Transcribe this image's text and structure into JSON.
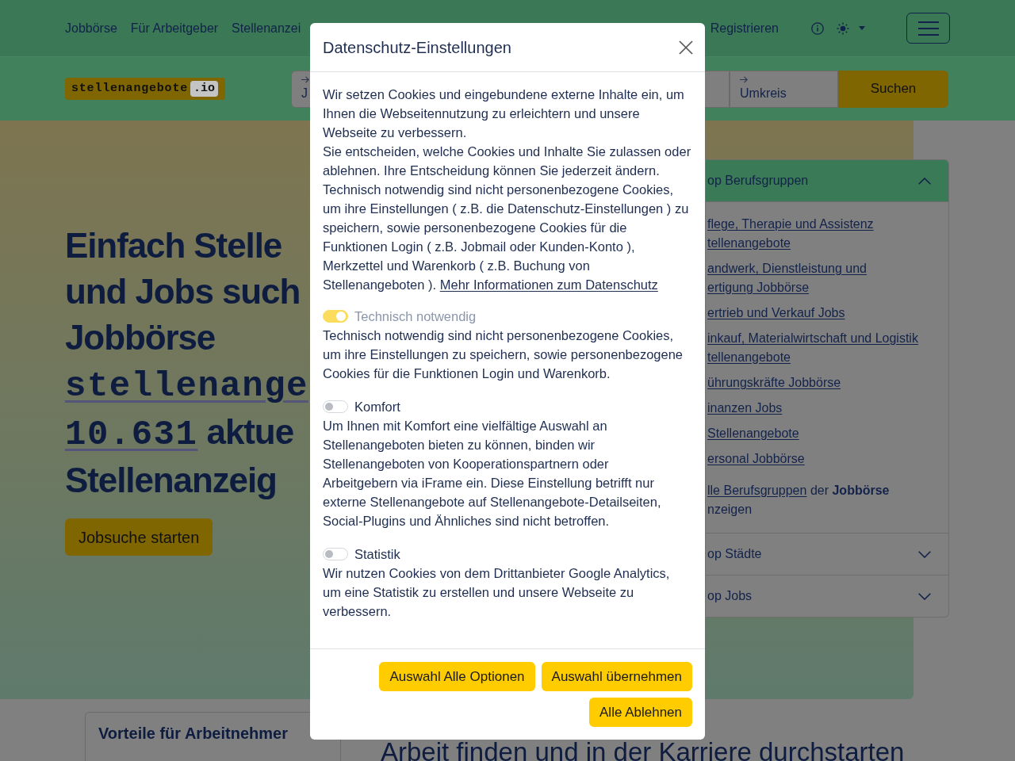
{
  "nav": {
    "links": [
      {
        "text": "Jobbörse"
      },
      {
        "text": "Für Arbeitgeber"
      },
      {
        "text": "Stellenanzei"
      }
    ],
    "register": "Registrieren"
  },
  "search_bar": {
    "logo": {
      "name": "stellenangebote",
      "suffix": ".io"
    },
    "fields": [
      {
        "value": "J"
      },
      {
        "value": "Umkreis"
      }
    ],
    "button": "Suchen"
  },
  "hero": {
    "heading_lines": [
      [
        {
          "kind": "text",
          "text": "Einfach Stelle"
        }
      ],
      [
        {
          "kind": "text",
          "text": "und Jobs such"
        }
      ],
      [
        {
          "kind": "text",
          "text": "Jobbörse"
        }
      ],
      [
        {
          "kind": "link",
          "text": "stellenange"
        }
      ],
      [
        {
          "kind": "link",
          "text": "10.631"
        },
        {
          "kind": "text",
          "text": "aktue"
        }
      ],
      [
        {
          "kind": "text",
          "text": "Stellenanzeig"
        }
      ]
    ],
    "button": "Jobsuche starten"
  },
  "accordion": [
    {
      "title": "op Berufsgruppen",
      "expanded": true,
      "links": [
        {
          "lines": [
            "flege, Therapie und Assistenz",
            "tellenangebote"
          ]
        },
        {
          "lines": [
            "andwerk, Dienstleistung und",
            "ertigung Jobbörse"
          ]
        },
        {
          "lines": [
            "ertrieb und Verkauf Jobs"
          ]
        },
        {
          "lines": [
            "inkauf, Materialwirtschaft und Logistik",
            "tellenangebote"
          ]
        },
        {
          "lines": [
            "ührungskräfte Jobbörse"
          ]
        },
        {
          "lines": [
            "inanzen Jobs"
          ]
        },
        {
          "lines": [
            "Stellenangebote"
          ]
        },
        {
          "lines": [
            "ersonal Jobbörse"
          ]
        }
      ],
      "footer_lines": [
        [
          {
            "kind": "link",
            "text": "lle Berufsgruppen"
          },
          {
            "kind": "text",
            "text": "der **Jobbörse**"
          }
        ],
        [
          {
            "kind": "text",
            "text": "nzeigen"
          }
        ]
      ]
    },
    {
      "title": "op Städte",
      "expanded": false
    },
    {
      "title": "op Jobs",
      "expanded": false
    }
  ],
  "benefits_card": {
    "title": "Vorteile für Arbeitnehmer"
  },
  "section_heading": "Arbeit finden und in der Karriere durchstarten",
  "modal": {
    "title": "Datenschutz-Einstellungen",
    "intro": [
      "Wir setzen Cookies und eingebundene externe Inhalte ein, um Ihnen die Webseitennutzung zu erleichtern und unsere Webseite zu verbessern.",
      "Sie entscheiden, welche Cookies und Inhalte Sie zulassen oder ablehnen. Ihre Entscheidung können Sie jederzeit ändern.",
      "Technisch notwendig sind nicht personenbezogene Cookies, um ihre Einstellungen ( z.B. die Datenschutz-Einstellungen ) zu speichern, sowie personenbezogene Cookies für die Funktionen Login ( z.B. Jobmail oder Kunden-Konto ), Merkzettel und Warenkorb ( z.B. Buchung von Stellenangeboten )."
    ],
    "link": "Mehr Informationen zum Datenschutz",
    "options": [
      {
        "label": "Technisch notwendig",
        "on": true,
        "disabled": true,
        "description": "Technisch notwendig sind nicht personenbezogene Cookies, um ihre Einstellungen zu speichern, sowie personenbezogene Cookies für die Funktionen Login und Warenkorb."
      },
      {
        "label": "Komfort",
        "on": false,
        "disabled": false,
        "description": "Um Ihnen mit Komfort eine vielfältige Auswahl an Stellenangeboten bieten zu können, binden wir Stellenangeboten von Kooperationspartnern oder Arbeitgebern via iFrame ein. Diese Einstellung betrifft nur externe Stellenangebote auf Stellenangebote-Detailseiten, Social-Plugins und Ähnliches sind nicht betroffen."
      },
      {
        "label": "Statistik",
        "on": false,
        "disabled": false,
        "description": "Wir nutzen Cookies von dem Drittanbieter Google Analytics, um eine Statistik zu erstellen und unsere Webseite zu verbessern."
      }
    ],
    "buttons": [
      "Auswahl Alle Optionen",
      "Auswahl übernehmen",
      "Alle Ablehnen"
    ]
  }
}
